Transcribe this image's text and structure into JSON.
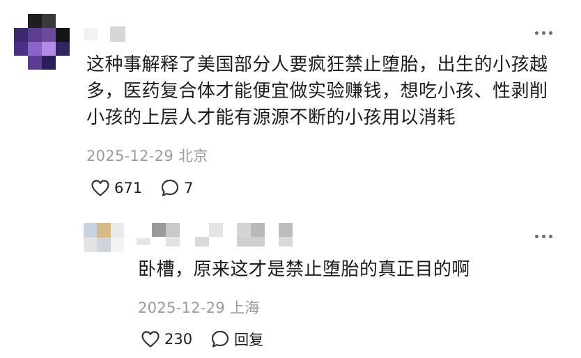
{
  "comment": {
    "text": "这种事解释了美国部分人要疯狂禁止堕胎，出生的小孩越多，医药复合体才能便宜做实验赚钱，想吃小孩、性剥削小孩的上层人才能有源源不断的小孩用以消耗",
    "date": "2025-12-29",
    "location": "北京",
    "likes": "671",
    "replies": "7",
    "icons": {
      "like": "heart-icon",
      "comment": "comment-bubble-icon",
      "more": "more-dots-icon"
    }
  },
  "reply": {
    "text": "卧槽，原来这才是禁止堕胎的真正目的啊",
    "date": "2025-12-29",
    "location": "上海",
    "likes": "230",
    "reply_label": "回复",
    "icons": {
      "like": "heart-icon",
      "reply": "comment-bubble-icon",
      "more": "more-dots-icon"
    }
  },
  "colors": {
    "text": "#1c1c1c",
    "meta": "#9a9a9a",
    "icon": "#333333"
  }
}
